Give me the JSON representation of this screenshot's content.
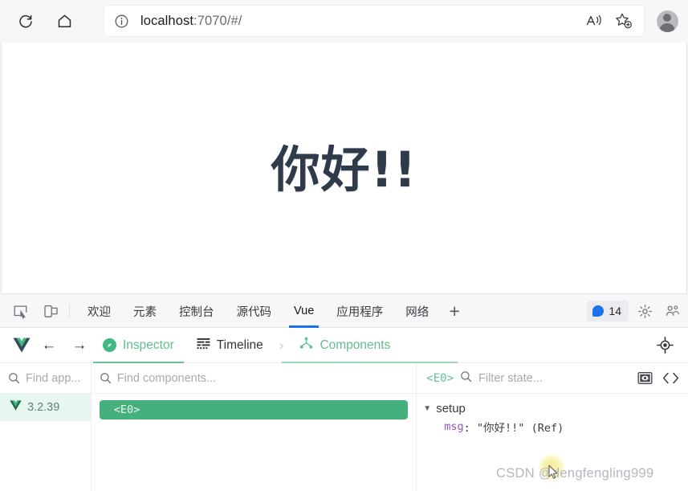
{
  "browser": {
    "reload_icon": "reload-icon",
    "home_icon": "home-icon",
    "info_icon": "site-info-icon",
    "url_main": "localhost",
    "url_rest": ":7070/#/",
    "read_aloud_icon": "read-aloud-icon",
    "favorite_icon": "add-favorite-icon",
    "profile_icon": "profile-avatar"
  },
  "page": {
    "heading": "你好!!"
  },
  "devtools": {
    "left_icons": [
      "inspect-element-icon",
      "device-toolbar-icon"
    ],
    "tabs": [
      {
        "label": "欢迎",
        "active": false
      },
      {
        "label": "元素",
        "active": false
      },
      {
        "label": "控制台",
        "active": false
      },
      {
        "label": "源代码",
        "active": false
      },
      {
        "label": "Vue",
        "active": true
      },
      {
        "label": "应用程序",
        "active": false
      },
      {
        "label": "网络",
        "active": false
      }
    ],
    "add_tab_label": "+",
    "issues_count": "14",
    "settings_icon": "gear-icon",
    "more_icon": "more-tools-icon"
  },
  "vue_header": {
    "logo": "vue-logo",
    "back_arrow": "←",
    "forward_arrow": "→",
    "inspector_label": "Inspector",
    "timeline_label": "Timeline",
    "chevron": "›",
    "components_label": "Components",
    "target_icon": "select-component-icon"
  },
  "apps_panel": {
    "search_placeholder": "Find app...",
    "app_version": "3.2.39"
  },
  "tree_panel": {
    "search_placeholder": "Find components...",
    "selected_component": "<E0>"
  },
  "state_panel": {
    "component_tag": "<E0>",
    "filter_placeholder": "Filter state...",
    "eye_icon": "toggle-visibility-icon",
    "code_icon": "open-in-editor-icon",
    "groups": [
      {
        "name": "setup",
        "expanded": true,
        "rows": [
          {
            "key": "msg",
            "value": ": \"你好!!\" (Ref)"
          }
        ]
      }
    ]
  },
  "watermark": {
    "text": "CSDN @dengfengling999"
  },
  "colors": {
    "vue_green": "#42b883",
    "selected_node": "#45b07c",
    "tab_active_underline": "#1a73e8",
    "heading": "#2f3b4b",
    "state_key": "#9a54c8"
  }
}
